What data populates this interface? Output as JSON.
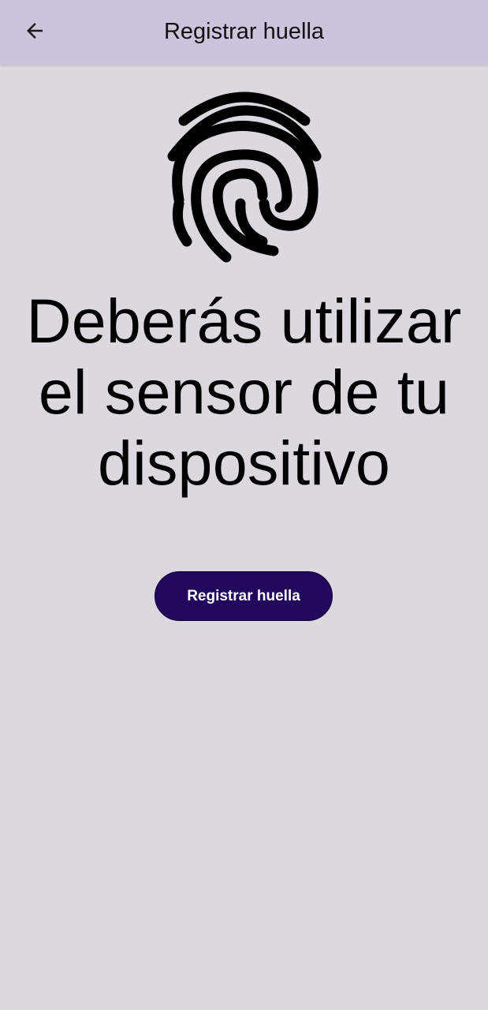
{
  "app_bar": {
    "title": "Registrar huella",
    "back_icon": "arrow-left-icon",
    "background": "#cdc3dc"
  },
  "illustration": {
    "icon": "fingerprint-icon"
  },
  "main": {
    "headline": "Deberás utilizar el sensor de tu dispositivo"
  },
  "actions": {
    "register_label": "Registrar huella",
    "button_color": "#22075e"
  },
  "colors": {
    "background": "#dcd8e0"
  }
}
